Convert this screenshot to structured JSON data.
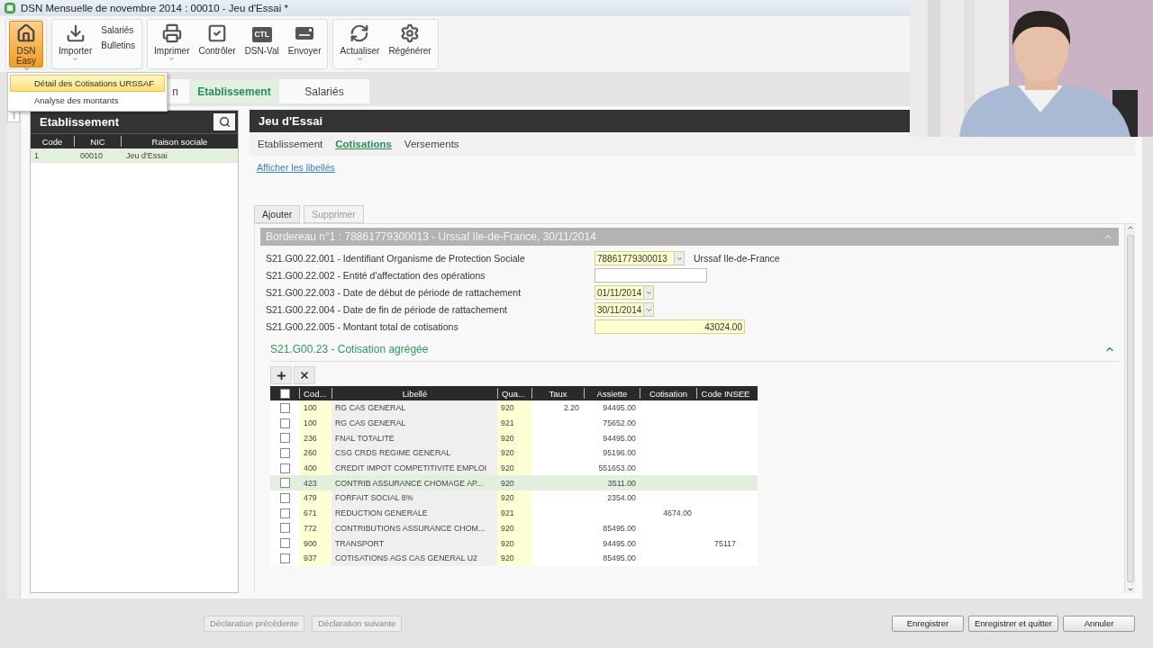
{
  "window": {
    "title": "DSN Mensuelle de novembre 2014 : 00010 - Jeu d'Essai *"
  },
  "ribbon": {
    "groups": [
      {
        "buttons": [
          {
            "kind": "large",
            "label": "DSN Easy",
            "active": true,
            "menu": true
          }
        ]
      },
      {
        "buttons": [
          {
            "kind": "large",
            "label": "Importer",
            "active": false,
            "menu": true
          },
          {
            "kind": "small",
            "label": "Salariés",
            "active": false
          },
          {
            "kind": "small",
            "label": "Bulletins",
            "active": false
          }
        ]
      },
      {
        "buttons": [
          {
            "kind": "large",
            "label": "Imprimer",
            "active": false,
            "menu": true
          },
          {
            "kind": "large",
            "label": "Contrôler",
            "active": false,
            "menu": false
          },
          {
            "kind": "large",
            "label": "DSN-Val",
            "badge": "CTL",
            "active": false,
            "menu": false
          },
          {
            "kind": "large",
            "label": "Envoyer",
            "active": false,
            "menu": false
          }
        ]
      },
      {
        "buttons": [
          {
            "kind": "large",
            "label": "Actualiser",
            "active": false,
            "menu": true
          },
          {
            "kind": "large",
            "label": "Régénérer",
            "active": false,
            "menu": false
          }
        ]
      }
    ]
  },
  "dropdown_menu": {
    "items": [
      {
        "label": "Détail des Cotisations URSSAF",
        "selected": true
      },
      {
        "label": "Analyse des montants",
        "selected": false
      }
    ]
  },
  "tabs": [
    {
      "label": "n",
      "selected": false
    },
    {
      "label": "Etablissement",
      "selected": true
    },
    {
      "label": "Salariés",
      "selected": false
    }
  ],
  "left_panel": {
    "title": "Etablissement",
    "columns": [
      "Code",
      "NIC",
      "Raison sociale"
    ],
    "rows": [
      {
        "code": "1",
        "nic": "00010",
        "raison_sociale": "Jeu d'Essai",
        "selected": true
      }
    ]
  },
  "right_panel": {
    "title": "Jeu d'Essai",
    "subtabs": [
      {
        "label": "Etablissement",
        "selected": false
      },
      {
        "label": "Cotisations",
        "selected": true
      },
      {
        "label": "Versements",
        "selected": false
      }
    ],
    "link": "Afficher les libellés",
    "buttons": [
      {
        "label": "Ajouter",
        "disabled": false
      },
      {
        "label": "Supprimer",
        "disabled": true
      }
    ],
    "section": {
      "title": "Bordereau n°1 : 78861779300013 - Urssaf Ile-de-France, 30/11/2014",
      "expanded": true,
      "fields": [
        {
          "label": "S21.G00.22.001 - Identifiant Organisme de Protection Sociale",
          "kind": "combo",
          "value": "78861779300013",
          "required": true,
          "note": "Urssaf Ile-de-France"
        },
        {
          "label": "S21.G00.22.002 - Entité d'affectation des opérations",
          "kind": "text",
          "required": false
        },
        {
          "label": "S21.G00.22.003 - Date de début de période de rattachement",
          "kind": "date",
          "value": "01/11/2014",
          "required": true
        },
        {
          "label": "S21.G00.22.004 - Date de fin de période de rattachement",
          "kind": "date",
          "value": "30/11/2014",
          "required": true
        },
        {
          "label": "S21.G00.22.005 - Montant total de cotisations",
          "kind": "amount",
          "value": "43024.00",
          "required": true
        }
      ]
    },
    "subsection": {
      "title": "S21.G00.23 - Cotisation agrégée",
      "expanded": true,
      "table": {
        "header_checked": false,
        "columns": [
          "Cod...",
          "Libellé",
          "Qua...",
          "Taux",
          "Assiette",
          "Cotisation",
          "Code INSEE"
        ],
        "rows": [
          {
            "checked": false,
            "selected": false,
            "code": "100",
            "libelle": "RG CAS GENERAL",
            "qualifiant": "920",
            "taux": "2.20",
            "assiette": "94495.00"
          },
          {
            "checked": false,
            "selected": false,
            "code": "100",
            "libelle": "RG CAS GENERAL",
            "qualifiant": "921",
            "assiette": "75652.00"
          },
          {
            "checked": false,
            "selected": false,
            "code": "236",
            "libelle": "FNAL TOTALITE",
            "qualifiant": "920",
            "assiette": "94495.00"
          },
          {
            "checked": false,
            "selected": false,
            "code": "260",
            "libelle": "CSG CRDS REGIME GENERAL",
            "qualifiant": "920",
            "assiette": "95196.00"
          },
          {
            "checked": false,
            "selected": false,
            "code": "400",
            "libelle": "CREDIT IMPOT COMPETITIVITE EMPLOI",
            "qualifiant": "920",
            "assiette": "551653.00"
          },
          {
            "checked": false,
            "selected": true,
            "code": "423",
            "libelle": "CONTRIB ASSURANCE CHOMAGE AP...",
            "qualifiant": "920",
            "assiette": "3511.00"
          },
          {
            "checked": false,
            "selected": false,
            "code": "479",
            "libelle": "FORFAIT SOCIAL 8%",
            "qualifiant": "920",
            "assiette": "2354.00"
          },
          {
            "checked": false,
            "selected": false,
            "code": "671",
            "libelle": "REDUCTION GENERALE",
            "qualifiant": "921",
            "cotisation": "4674.00"
          },
          {
            "checked": false,
            "selected": false,
            "code": "772",
            "libelle": "CONTRIBUTIONS ASSURANCE CHOM...",
            "qualifiant": "920",
            "assiette": "85495.00"
          },
          {
            "checked": false,
            "selected": false,
            "code": "900",
            "libelle": "TRANSPORT",
            "qualifiant": "920",
            "assiette": "94495.00",
            "code_insee": "75117"
          },
          {
            "checked": false,
            "selected": false,
            "code": "937",
            "libelle": "COTISATIONS AGS CAS GENERAL U2",
            "qualifiant": "920",
            "assiette": "85495.00"
          }
        ]
      }
    }
  },
  "footer": {
    "nav_buttons": [
      {
        "label": "Déclaration précédente",
        "disabled": true
      },
      {
        "label": "Déclaration suivante",
        "disabled": true
      }
    ],
    "action_buttons": [
      {
        "label": "Enregistrer",
        "disabled": false
      },
      {
        "label": "Enregistrer et quitter",
        "disabled": false
      },
      {
        "label": "Annuler",
        "disabled": false
      }
    ]
  }
}
